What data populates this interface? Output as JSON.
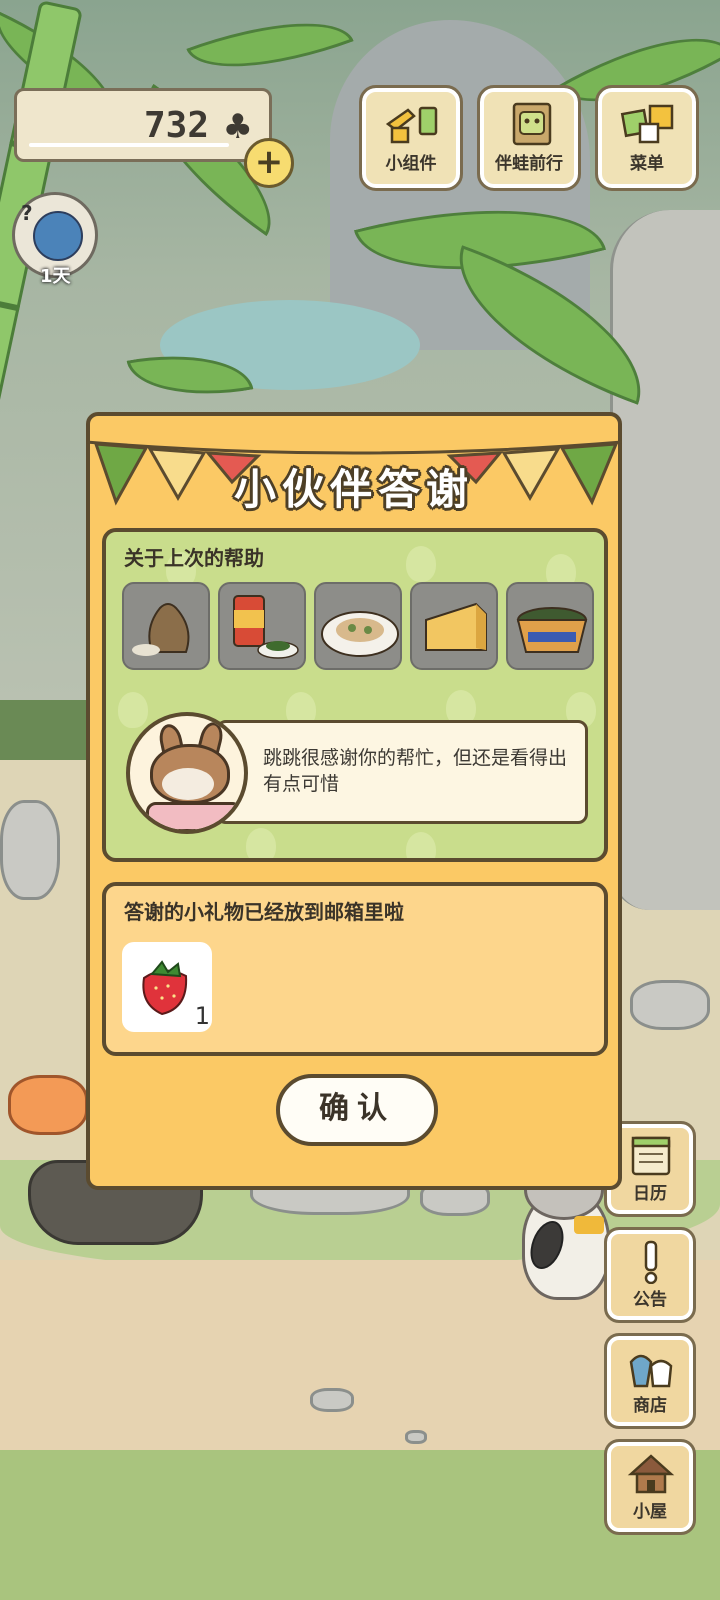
{
  "hud": {
    "clover_count": "732",
    "clover_icon": "♣",
    "add_label": "+",
    "visitor_days": "1天",
    "visitor_mark": "?"
  },
  "top_menu": [
    {
      "label": "小组件",
      "icon": "widget-icon"
    },
    {
      "label": "伴蛙前行",
      "icon": "frog-book-icon"
    },
    {
      "label": "菜单",
      "icon": "menu-cards-icon"
    }
  ],
  "side_menu": [
    {
      "label": "日历",
      "icon": "calendar-icon"
    },
    {
      "label": "公告",
      "icon": "notice-icon"
    },
    {
      "label": "商店",
      "icon": "shop-bags-icon"
    },
    {
      "label": "小屋",
      "icon": "house-icon"
    }
  ],
  "dialog": {
    "title": "小伙伴答谢",
    "help_section": {
      "title": "关于上次的帮助",
      "items": [
        {
          "name": "grain-sack-icon"
        },
        {
          "name": "canned-food-icon"
        },
        {
          "name": "pasta-plate-icon"
        },
        {
          "name": "cheese-icon"
        },
        {
          "name": "noodle-bowl-icon"
        }
      ],
      "message": "跳跳很感谢你的帮忙，但还是看得出有点可惜"
    },
    "gift_section": {
      "title": "答谢的小礼物已经放到邮箱里啦",
      "gift": {
        "name": "strawberry-icon",
        "quantity": "1"
      }
    },
    "confirm_label": "确认"
  },
  "colors": {
    "dialog_bg": "#fbc965",
    "help_panel_bg": "#c9dd8c",
    "gift_panel_bg": "#fdd68c",
    "border": "#5b4b2f"
  }
}
